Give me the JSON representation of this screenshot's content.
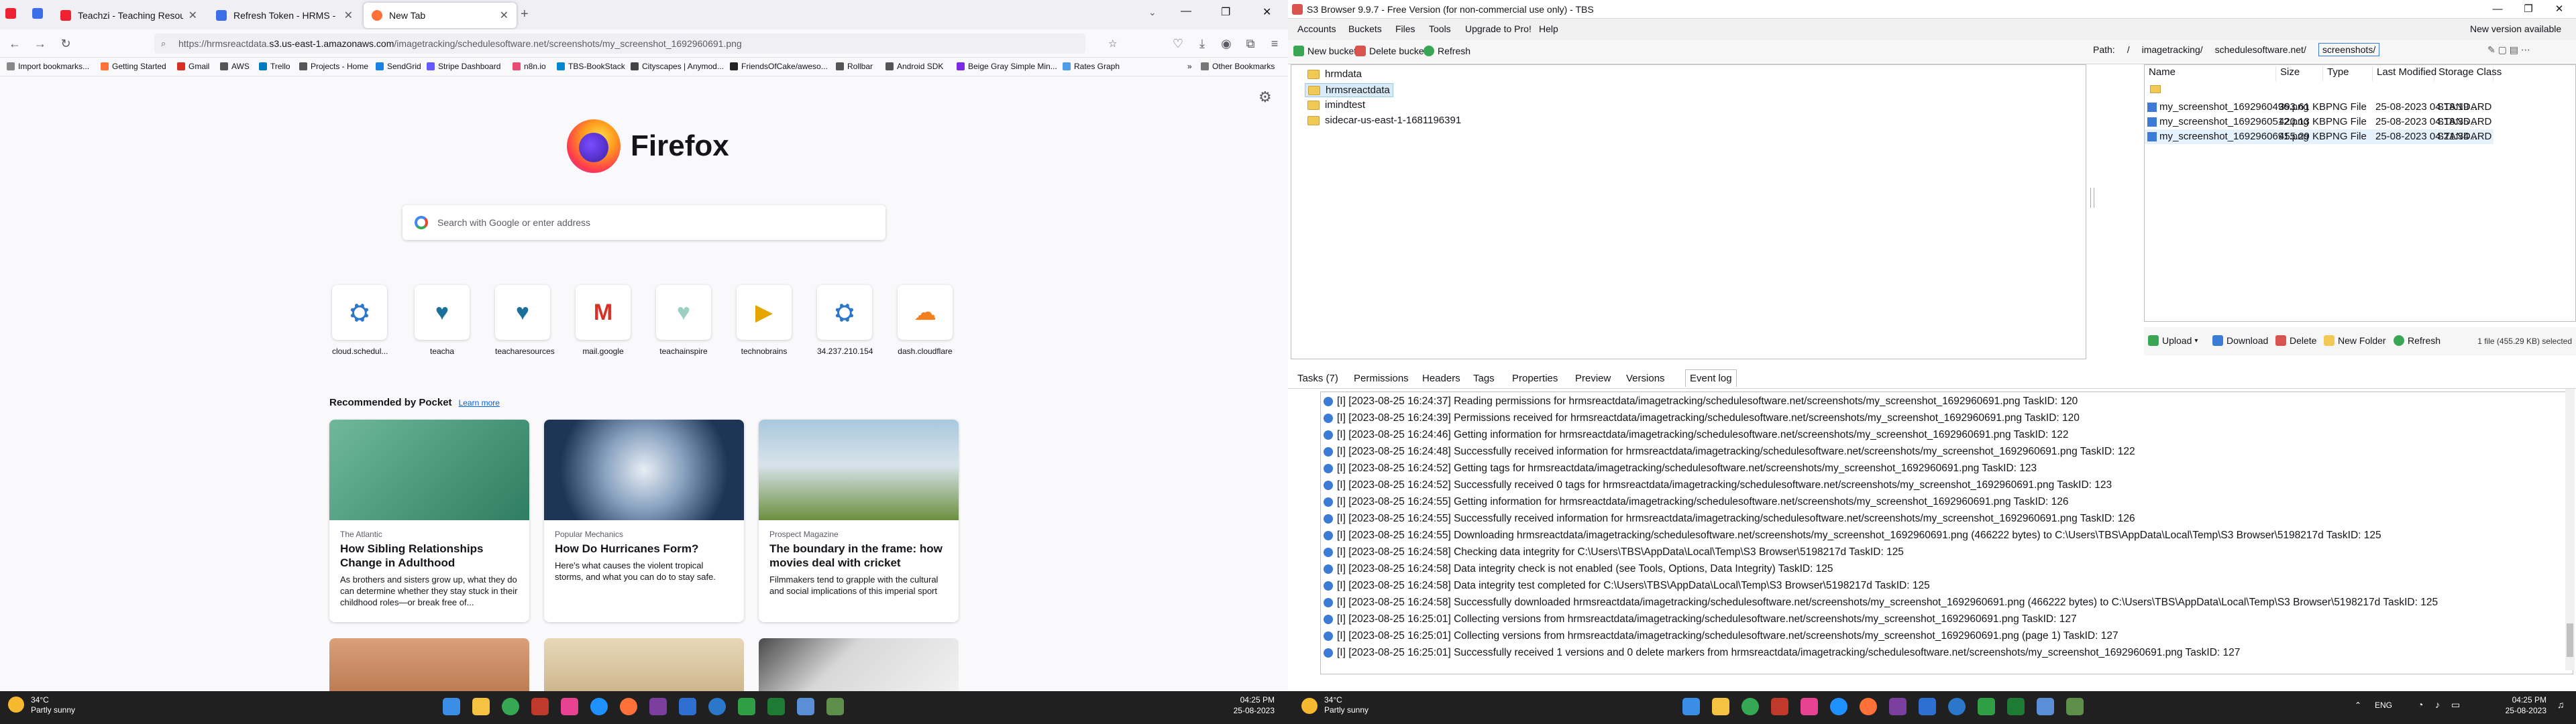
{
  "firefox": {
    "tabs": [
      {
        "label": "Teachzi - Teaching Resources Mac",
        "color": "#e23"
      },
      {
        "label": "Refresh Token - HRMS - React",
        "color": "#3b6ee8"
      },
      {
        "label": "New Tab",
        "color": "#ff7139"
      }
    ],
    "url_prefix": "https://hrmsreactdata.",
    "url_host": "s3.us-east-1.amazonaws.com",
    "url_path": "/imagetracking/schedulesoftware.net/screenshots/my_screenshot_1692960691.png",
    "bookmarks": [
      "Import bookmarks...",
      "Getting Started",
      "Gmail",
      "AWS",
      "Trello",
      "Projects - Home",
      "SendGrid",
      "Stripe Dashboard",
      "n8n.io",
      "TBS-BookStack",
      "Cityscapes | Anymod...",
      "FriendsOfCake/aweso...",
      "Rollbar",
      "Android SDK",
      "Beige Gray Simple Min...",
      "Rates Graph"
    ],
    "other_bookmarks": "Other Bookmarks",
    "brand": "Firefox",
    "search_placeholder": "Search with Google or enter address",
    "sites": [
      {
        "label": "cloud.schedul...",
        "glyph": "⛭",
        "color": "#2b77c9"
      },
      {
        "label": "teacha",
        "glyph": "♥",
        "color": "#1b6f9b"
      },
      {
        "label": "teacharesources",
        "glyph": "♥",
        "color": "#1b6f9b"
      },
      {
        "label": "mail.google",
        "glyph": "M",
        "color": "#d93025"
      },
      {
        "label": "teachainspire",
        "glyph": "♥",
        "color": "#9bd0c3"
      },
      {
        "label": "technobrains",
        "glyph": "▶",
        "color": "#e5a400"
      },
      {
        "label": "34.237.210.154",
        "glyph": "⛭",
        "color": "#2b77c9"
      },
      {
        "label": "dash.cloudflare",
        "glyph": "☁",
        "color": "#f38020"
      }
    ],
    "pocket_title": "Recommended by Pocket",
    "pocket_link": "Learn more",
    "cards": [
      {
        "source": "The Atlantic",
        "title": "How Sibling Relationships Change in Adulthood",
        "excerpt": "As brothers and sisters grow up, what they do can determine whether they stay stuck in their childhood roles—or break free of...",
        "img": "#5aa58b"
      },
      {
        "source": "Popular Mechanics",
        "title": "How Do Hurricanes Form?",
        "excerpt": "Here's what causes the violent tropical storms, and what you can do to stay safe.",
        "img": "#3a5273"
      },
      {
        "source": "Prospect Magazine",
        "title": "The boundary in the frame: how movies deal with cricket",
        "excerpt": "Filmmakers tend to grapple with the cultural and social implications of this imperial sport",
        "img": "#8fb4cc"
      }
    ],
    "weather": {
      "temp": "34°C",
      "cond": "Partly sunny"
    },
    "clock": {
      "time": "04:25 PM",
      "date": "25-08-2023"
    }
  },
  "s3": {
    "title": "S3 Browser 9.9.7 - Free Version (for non-commercial use only) - TBS",
    "menu": [
      "Accounts",
      "Buckets",
      "Files",
      "Tools",
      "Upgrade to Pro!",
      "Help"
    ],
    "new_version": "New version available",
    "toolbar": {
      "new_bucket": "New bucket",
      "delete_bucket": "Delete bucket",
      "refresh": "Refresh"
    },
    "path": {
      "label": "Path:",
      "segs": [
        "/",
        "imagetracking/",
        "schedulesoftware.net/"
      ],
      "current": "screenshots/"
    },
    "buckets": [
      "hrmdata",
      "hrmsreactdata",
      "imindtest",
      "sidecar-us-east-1-1681196391"
    ],
    "selected_bucket": 1,
    "columns": [
      "Name",
      "Size",
      "Type",
      "Last Modified",
      "Storage Class"
    ],
    "files": [
      {
        "name": "my_screenshot_1692960496.png",
        "size": "393.61 KB",
        "type": "PNG File",
        "modified": "25-08-2023 04:18:19 ...",
        "storage": "STANDARD"
      },
      {
        "name": "my_screenshot_1692960512.png",
        "size": "420.13 KB",
        "type": "PNG File",
        "modified": "25-08-2023 04:18:35 ...",
        "storage": "STANDARD"
      },
      {
        "name": "my_screenshot_1692960691.png",
        "size": "455.29 KB",
        "type": "PNG File",
        "modified": "25-08-2023 04:21:34 ...",
        "storage": "STANDARD"
      }
    ],
    "file_actions": {
      "upload": "Upload",
      "download": "Download",
      "delete": "Delete",
      "new_folder": "New Folder",
      "refresh": "Refresh"
    },
    "selection_status": "1 file (455.29 KB) selected",
    "bottom_tabs": [
      "Tasks (7)",
      "Permissions",
      "Headers",
      "Tags",
      "Properties",
      "Preview",
      "Versions",
      "Event log"
    ],
    "log": [
      "[I] [2023-08-25 16:24:37] Reading permissions for hrmsreactdata/imagetracking/schedulesoftware.net/screenshots/my_screenshot_1692960691.png TaskID: 120",
      "[I] [2023-08-25 16:24:39] Permissions received for hrmsreactdata/imagetracking/schedulesoftware.net/screenshots/my_screenshot_1692960691.png TaskID: 120",
      "[I] [2023-08-25 16:24:46] Getting information for hrmsreactdata/imagetracking/schedulesoftware.net/screenshots/my_screenshot_1692960691.png TaskID: 122",
      "[I] [2023-08-25 16:24:48] Successfully received information for hrmsreactdata/imagetracking/schedulesoftware.net/screenshots/my_screenshot_1692960691.png TaskID: 122",
      "[I] [2023-08-25 16:24:52] Getting tags for hrmsreactdata/imagetracking/schedulesoftware.net/screenshots/my_screenshot_1692960691.png TaskID: 123",
      "[I] [2023-08-25 16:24:52] Successfully received 0 tags for hrmsreactdata/imagetracking/schedulesoftware.net/screenshots/my_screenshot_1692960691.png TaskID: 123",
      "[I] [2023-08-25 16:24:55] Getting information for hrmsreactdata/imagetracking/schedulesoftware.net/screenshots/my_screenshot_1692960691.png TaskID: 126",
      "[I] [2023-08-25 16:24:55] Successfully received information for hrmsreactdata/imagetracking/schedulesoftware.net/screenshots/my_screenshot_1692960691.png TaskID: 126",
      "[I] [2023-08-25 16:24:55] Downloading hrmsreactdata/imagetracking/schedulesoftware.net/screenshots/my_screenshot_1692960691.png (466222 bytes) to C:\\Users\\TBS\\AppData\\Local\\Temp\\S3 Browser\\5198217d TaskID: 125",
      "[I] [2023-08-25 16:24:58] Checking data integrity for C:\\Users\\TBS\\AppData\\Local\\Temp\\S3 Browser\\5198217d TaskID: 125",
      "[I] [2023-08-25 16:24:58] Data integrity check is not enabled (see Tools, Options, Data Integrity) TaskID: 125",
      "[I] [2023-08-25 16:24:58] Data integrity test completed for C:\\Users\\TBS\\AppData\\Local\\Temp\\S3 Browser\\5198217d TaskID: 125",
      "[I] [2023-08-25 16:24:58] Successfully downloaded hrmsreactdata/imagetracking/schedulesoftware.net/screenshots/my_screenshot_1692960691.png (466222 bytes) to C:\\Users\\TBS\\AppData\\Local\\Temp\\S3 Browser\\5198217d TaskID: 125",
      "[I] [2023-08-25 16:25:01] Collecting versions from hrmsreactdata/imagetracking/schedulesoftware.net/screenshots/my_screenshot_1692960691.png TaskID: 127",
      "[I] [2023-08-25 16:25:01] Collecting versions from hrmsreactdata/imagetracking/schedulesoftware.net/screenshots/my_screenshot_1692960691.png (page 1) TaskID: 127",
      "[I] [2023-08-25 16:25:01] Successfully received 1 versions and 0 delete markers from hrmsreactdata/imagetracking/schedulesoftware.net/screenshots/my_screenshot_1692960691.png TaskID: 127"
    ],
    "tray": {
      "lang": "ENG"
    },
    "weather": {
      "temp": "34°C",
      "cond": "Partly sunny"
    },
    "clock": {
      "time": "04:25 PM",
      "date": "25-08-2023"
    }
  }
}
